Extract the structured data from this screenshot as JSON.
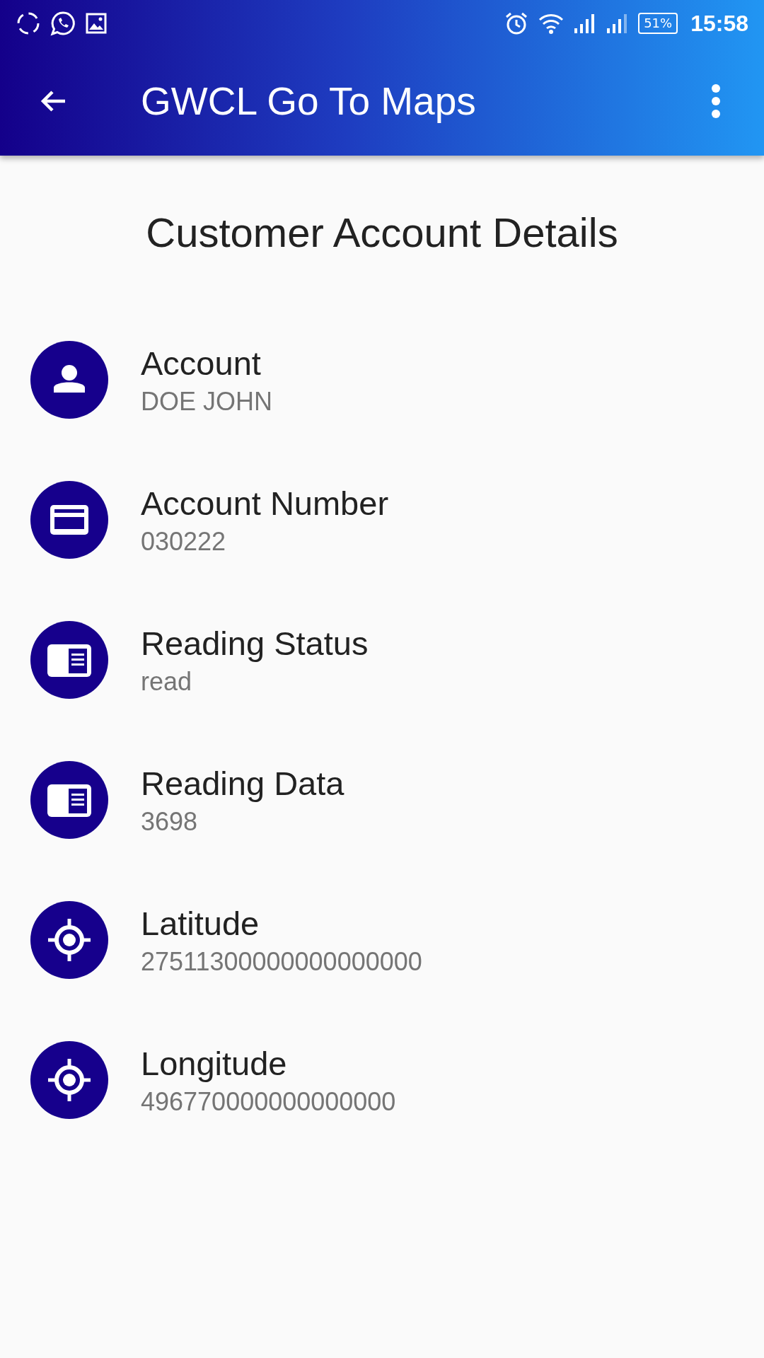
{
  "status_bar": {
    "battery": "51%",
    "time": "15:58"
  },
  "app_bar": {
    "title": "GWCL Go To Maps"
  },
  "heading": "Customer Account Details",
  "details": [
    {
      "kind": "person",
      "label": "Account",
      "value": "DOE JOHN"
    },
    {
      "kind": "card",
      "label": "Account Number",
      "value": "030222"
    },
    {
      "kind": "reader",
      "label": "Reading Status",
      "value": "read"
    },
    {
      "kind": "reader",
      "label": "Reading Data",
      "value": "3698"
    },
    {
      "kind": "target",
      "label": "Latitude",
      "value": "27511300000000000000"
    },
    {
      "kind": "target",
      "label": "Longitude",
      "value": "496770000000000000"
    }
  ]
}
